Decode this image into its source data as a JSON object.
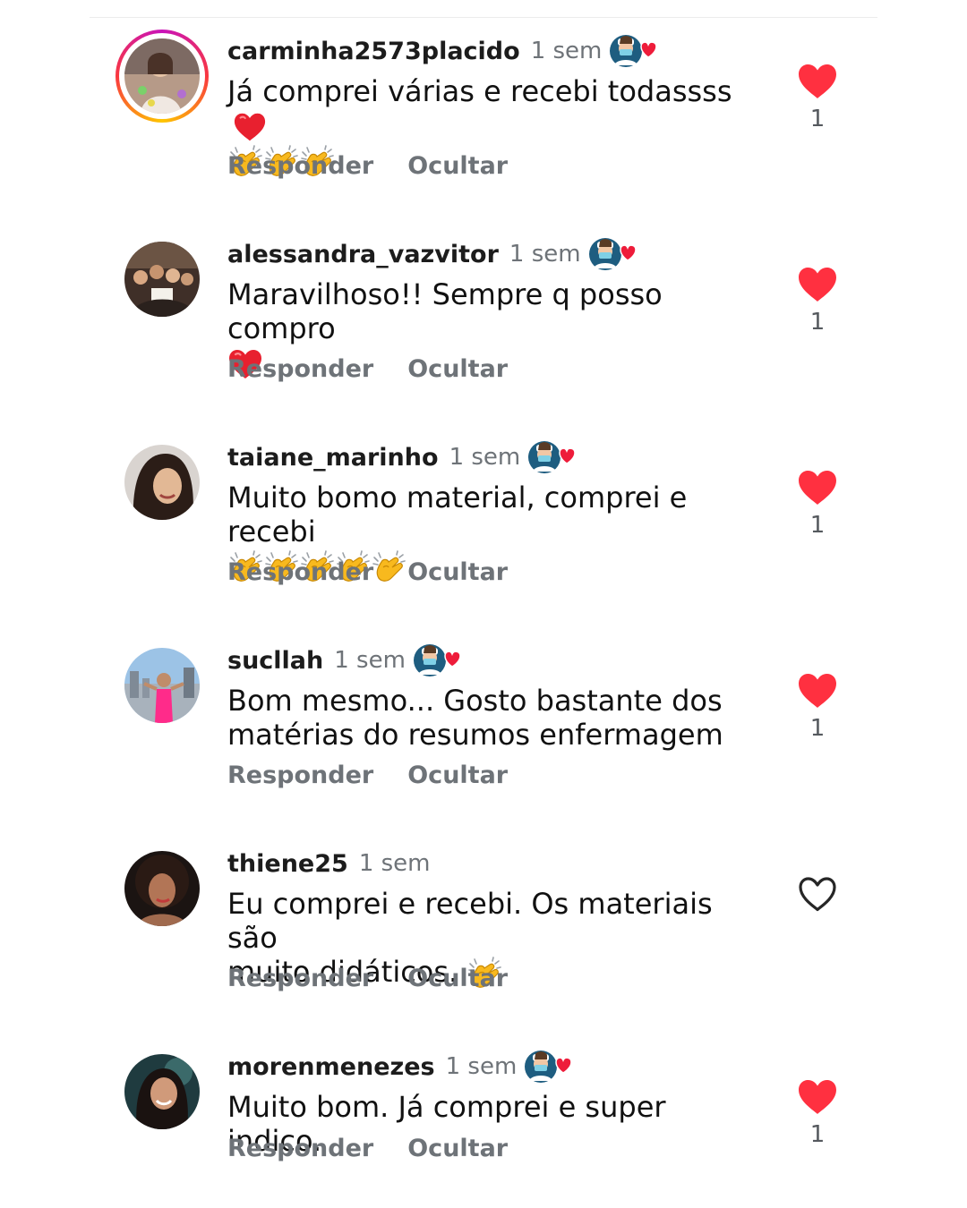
{
  "actions": {
    "reply_label": "Responder",
    "hide_label": "Ocultar"
  },
  "colors": {
    "like_red": "#ff3040",
    "muted_text": "#6e7378"
  },
  "icons": {
    "liked": "heart-filled-icon",
    "not_liked": "heart-outline-icon",
    "badge": "nurse-with-heart-badge-icon",
    "clap": "clapping-hands-emoji",
    "red_heart": "red-heart-emoji"
  },
  "comments": [
    {
      "username": "carminha2573placido",
      "time": "1 sem",
      "text_line1": "Já comprei várias e recebi todassss",
      "text_line2": "",
      "has_badge": true,
      "liked": true,
      "like_count": "1"
    },
    {
      "username": "alessandra_vazvitor",
      "time": "1 sem",
      "text_line1": "Maravilhoso!! Sempre q posso compro",
      "text_line2": "",
      "has_badge": true,
      "liked": true,
      "like_count": "1"
    },
    {
      "username": "taiane_marinho",
      "time": "1 sem",
      "text_line1": "Muito bomo material, comprei e recebi",
      "text_line2": "",
      "has_badge": true,
      "liked": true,
      "like_count": "1"
    },
    {
      "username": "sucllah",
      "time": "1 sem",
      "text_line1": "Bom mesmo... Gosto bastante dos",
      "text_line2": "matérias do resumos enfermagem",
      "has_badge": true,
      "liked": true,
      "like_count": "1"
    },
    {
      "username": "thiene25",
      "time": "1 sem",
      "text_line1": "Eu comprei e recebi. Os materiais são",
      "text_line2": "muito didáticos.",
      "has_badge": false,
      "liked": false,
      "like_count": ""
    },
    {
      "username": "morenmenezes",
      "time": "1 sem",
      "text_line1": "Muito bom. Já comprei e super indico.",
      "text_line2": "",
      "has_badge": true,
      "liked": true,
      "like_count": "1"
    }
  ]
}
